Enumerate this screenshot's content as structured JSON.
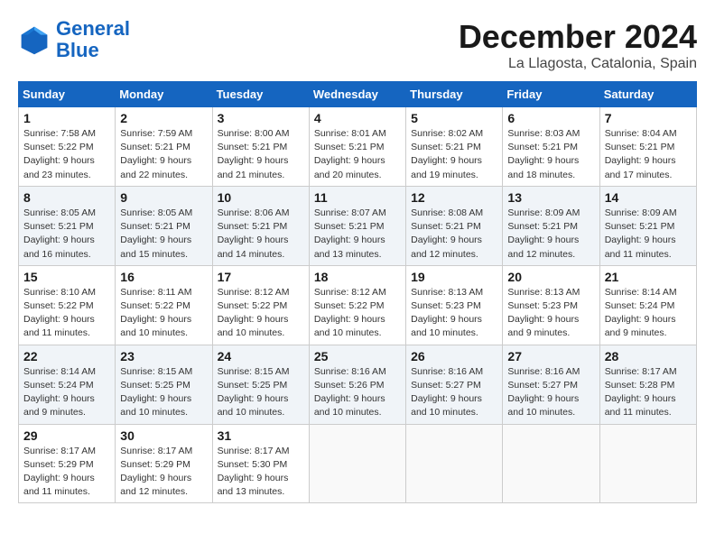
{
  "header": {
    "logo_line1": "General",
    "logo_line2": "Blue",
    "month": "December 2024",
    "location": "La Llagosta, Catalonia, Spain"
  },
  "weekdays": [
    "Sunday",
    "Monday",
    "Tuesday",
    "Wednesday",
    "Thursday",
    "Friday",
    "Saturday"
  ],
  "weeks": [
    [
      {
        "day": "1",
        "info": "Sunrise: 7:58 AM\nSunset: 5:22 PM\nDaylight: 9 hours\nand 23 minutes."
      },
      {
        "day": "2",
        "info": "Sunrise: 7:59 AM\nSunset: 5:21 PM\nDaylight: 9 hours\nand 22 minutes."
      },
      {
        "day": "3",
        "info": "Sunrise: 8:00 AM\nSunset: 5:21 PM\nDaylight: 9 hours\nand 21 minutes."
      },
      {
        "day": "4",
        "info": "Sunrise: 8:01 AM\nSunset: 5:21 PM\nDaylight: 9 hours\nand 20 minutes."
      },
      {
        "day": "5",
        "info": "Sunrise: 8:02 AM\nSunset: 5:21 PM\nDaylight: 9 hours\nand 19 minutes."
      },
      {
        "day": "6",
        "info": "Sunrise: 8:03 AM\nSunset: 5:21 PM\nDaylight: 9 hours\nand 18 minutes."
      },
      {
        "day": "7",
        "info": "Sunrise: 8:04 AM\nSunset: 5:21 PM\nDaylight: 9 hours\nand 17 minutes."
      }
    ],
    [
      {
        "day": "8",
        "info": "Sunrise: 8:05 AM\nSunset: 5:21 PM\nDaylight: 9 hours\nand 16 minutes."
      },
      {
        "day": "9",
        "info": "Sunrise: 8:05 AM\nSunset: 5:21 PM\nDaylight: 9 hours\nand 15 minutes."
      },
      {
        "day": "10",
        "info": "Sunrise: 8:06 AM\nSunset: 5:21 PM\nDaylight: 9 hours\nand 14 minutes."
      },
      {
        "day": "11",
        "info": "Sunrise: 8:07 AM\nSunset: 5:21 PM\nDaylight: 9 hours\nand 13 minutes."
      },
      {
        "day": "12",
        "info": "Sunrise: 8:08 AM\nSunset: 5:21 PM\nDaylight: 9 hours\nand 12 minutes."
      },
      {
        "day": "13",
        "info": "Sunrise: 8:09 AM\nSunset: 5:21 PM\nDaylight: 9 hours\nand 12 minutes."
      },
      {
        "day": "14",
        "info": "Sunrise: 8:09 AM\nSunset: 5:21 PM\nDaylight: 9 hours\nand 11 minutes."
      }
    ],
    [
      {
        "day": "15",
        "info": "Sunrise: 8:10 AM\nSunset: 5:22 PM\nDaylight: 9 hours\nand 11 minutes."
      },
      {
        "day": "16",
        "info": "Sunrise: 8:11 AM\nSunset: 5:22 PM\nDaylight: 9 hours\nand 10 minutes."
      },
      {
        "day": "17",
        "info": "Sunrise: 8:12 AM\nSunset: 5:22 PM\nDaylight: 9 hours\nand 10 minutes."
      },
      {
        "day": "18",
        "info": "Sunrise: 8:12 AM\nSunset: 5:22 PM\nDaylight: 9 hours\nand 10 minutes."
      },
      {
        "day": "19",
        "info": "Sunrise: 8:13 AM\nSunset: 5:23 PM\nDaylight: 9 hours\nand 10 minutes."
      },
      {
        "day": "20",
        "info": "Sunrise: 8:13 AM\nSunset: 5:23 PM\nDaylight: 9 hours\nand 9 minutes."
      },
      {
        "day": "21",
        "info": "Sunrise: 8:14 AM\nSunset: 5:24 PM\nDaylight: 9 hours\nand 9 minutes."
      }
    ],
    [
      {
        "day": "22",
        "info": "Sunrise: 8:14 AM\nSunset: 5:24 PM\nDaylight: 9 hours\nand 9 minutes."
      },
      {
        "day": "23",
        "info": "Sunrise: 8:15 AM\nSunset: 5:25 PM\nDaylight: 9 hours\nand 10 minutes."
      },
      {
        "day": "24",
        "info": "Sunrise: 8:15 AM\nSunset: 5:25 PM\nDaylight: 9 hours\nand 10 minutes."
      },
      {
        "day": "25",
        "info": "Sunrise: 8:16 AM\nSunset: 5:26 PM\nDaylight: 9 hours\nand 10 minutes."
      },
      {
        "day": "26",
        "info": "Sunrise: 8:16 AM\nSunset: 5:27 PM\nDaylight: 9 hours\nand 10 minutes."
      },
      {
        "day": "27",
        "info": "Sunrise: 8:16 AM\nSunset: 5:27 PM\nDaylight: 9 hours\nand 10 minutes."
      },
      {
        "day": "28",
        "info": "Sunrise: 8:17 AM\nSunset: 5:28 PM\nDaylight: 9 hours\nand 11 minutes."
      }
    ],
    [
      {
        "day": "29",
        "info": "Sunrise: 8:17 AM\nSunset: 5:29 PM\nDaylight: 9 hours\nand 11 minutes."
      },
      {
        "day": "30",
        "info": "Sunrise: 8:17 AM\nSunset: 5:29 PM\nDaylight: 9 hours\nand 12 minutes."
      },
      {
        "day": "31",
        "info": "Sunrise: 8:17 AM\nSunset: 5:30 PM\nDaylight: 9 hours\nand 13 minutes."
      },
      null,
      null,
      null,
      null
    ]
  ]
}
